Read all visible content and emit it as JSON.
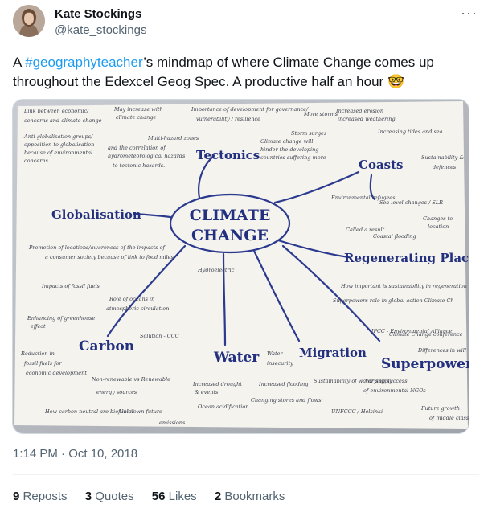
{
  "author": {
    "name": "Kate Stockings",
    "handle": "@kate_stockings"
  },
  "more_label": "···",
  "tweet": {
    "text_before": "A ",
    "hashtag": "#geographyteacher",
    "text_after": "’s mindmap of where Climate Change comes up throughout the Edexcel Geog Spec. A productive half an hour",
    "emoji": "🤓"
  },
  "mindmap": {
    "center_line1": "CLIMATE",
    "center_line2": "CHANGE",
    "branches": [
      "Tectonics",
      "Coasts",
      "Globalisation",
      "Regenerating Plac",
      "Carbon",
      "Water",
      "Migration",
      "Superpower"
    ],
    "notes": [
      "Link between economic/",
      "concerns and climate change",
      "Anti-globalisation groups/",
      "opposition to globalisation",
      "because of environmental",
      "concerns.",
      "May increase with",
      "climate change",
      "Multi-hazard zones",
      "and the correlation of",
      "hydrometeorological hazards",
      "to tectonic hazards.",
      "Importance of development for governance/",
      "vulnerability / resilience",
      "Storm surges",
      "More storms",
      "Increased erosion",
      "increased weathering",
      "Climate change will",
      "hinder the developing",
      "countries suffering more",
      "Increasing tides and sea",
      "Sustainability &",
      "defences",
      "Sea level changes / SLR",
      "Environmental refugees",
      "Called a result",
      "Coastal flooding",
      "Changes to",
      "location",
      "Promotion of locations/awareness of the impacts of",
      "a consumer society because of link to food miles.",
      "Impacts of fossil fuels",
      "Role of oceans in",
      "atmospheric circulation",
      "Enhancing of greenhouse",
      "effect",
      "Reduction in",
      "fossil fuels for",
      "economic development",
      "Non-renewable vs Renewable",
      "energy sources",
      "How carbon neutral are biofuels?",
      "Unknown future",
      "emissions",
      "Solution - CCC",
      "Hydroelectric",
      "Water",
      "insecurity",
      "Increased drought",
      "& events",
      "Ocean acidification",
      "Increased flooding",
      "Changing stores and flows",
      "Sustainability of water supply",
      "Varying success",
      "of environmental NGOs",
      "UNFCCC / Helsinki",
      "How important is sustainability in regeneration",
      "Superpowers role in global action Climate Ch",
      "IPCC - Environmental Alliance",
      "Climate Change conference",
      "Differences in will",
      "Future growth",
      "of middle class"
    ]
  },
  "timestamp": "1:14 PM · Oct 10, 2018",
  "stats": {
    "reposts_count": "9",
    "reposts_label": "Reposts",
    "quotes_count": "3",
    "quotes_label": "Quotes",
    "likes_count": "56",
    "likes_label": "Likes",
    "bookmarks_count": "2",
    "bookmarks_label": "Bookmarks"
  }
}
